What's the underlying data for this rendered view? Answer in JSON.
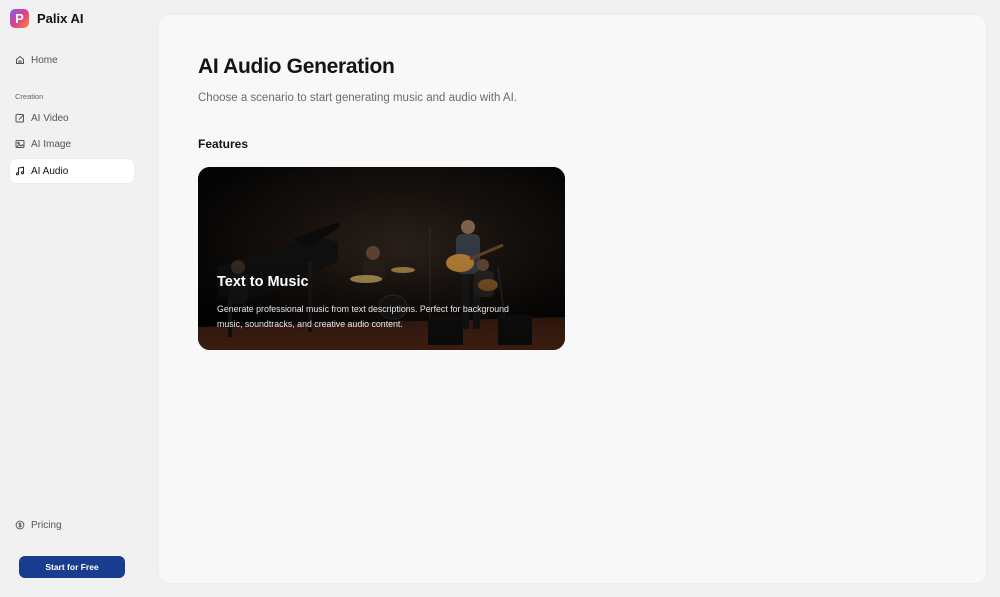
{
  "brand": {
    "name": "Palix AI",
    "logo_letter": "P"
  },
  "sidebar": {
    "home": {
      "label": "Home",
      "icon": "home-icon"
    },
    "section_label": "Creation",
    "items": [
      {
        "label": "AI Video",
        "icon": "video-edit-icon"
      },
      {
        "label": "AI Image",
        "icon": "image-icon"
      },
      {
        "label": "AI Audio",
        "icon": "music-note-icon",
        "active": true
      }
    ],
    "pricing": {
      "label": "Pricing",
      "icon": "dollar-circle-icon"
    },
    "cta_label": "Start for Free"
  },
  "main": {
    "title": "AI Audio Generation",
    "subtitle": "Choose a scenario to start generating music and audio with AI.",
    "features_heading": "Features",
    "cards": [
      {
        "title": "Text to Music",
        "description": "Generate professional music from text descriptions. Perfect for background music, soundtracks, and creative audio content.",
        "image": "jazz-band-on-stage"
      }
    ]
  },
  "colors": {
    "accent": "#1a3c8f",
    "background": "#f1f1f1",
    "panel": "#f8f8f8"
  }
}
